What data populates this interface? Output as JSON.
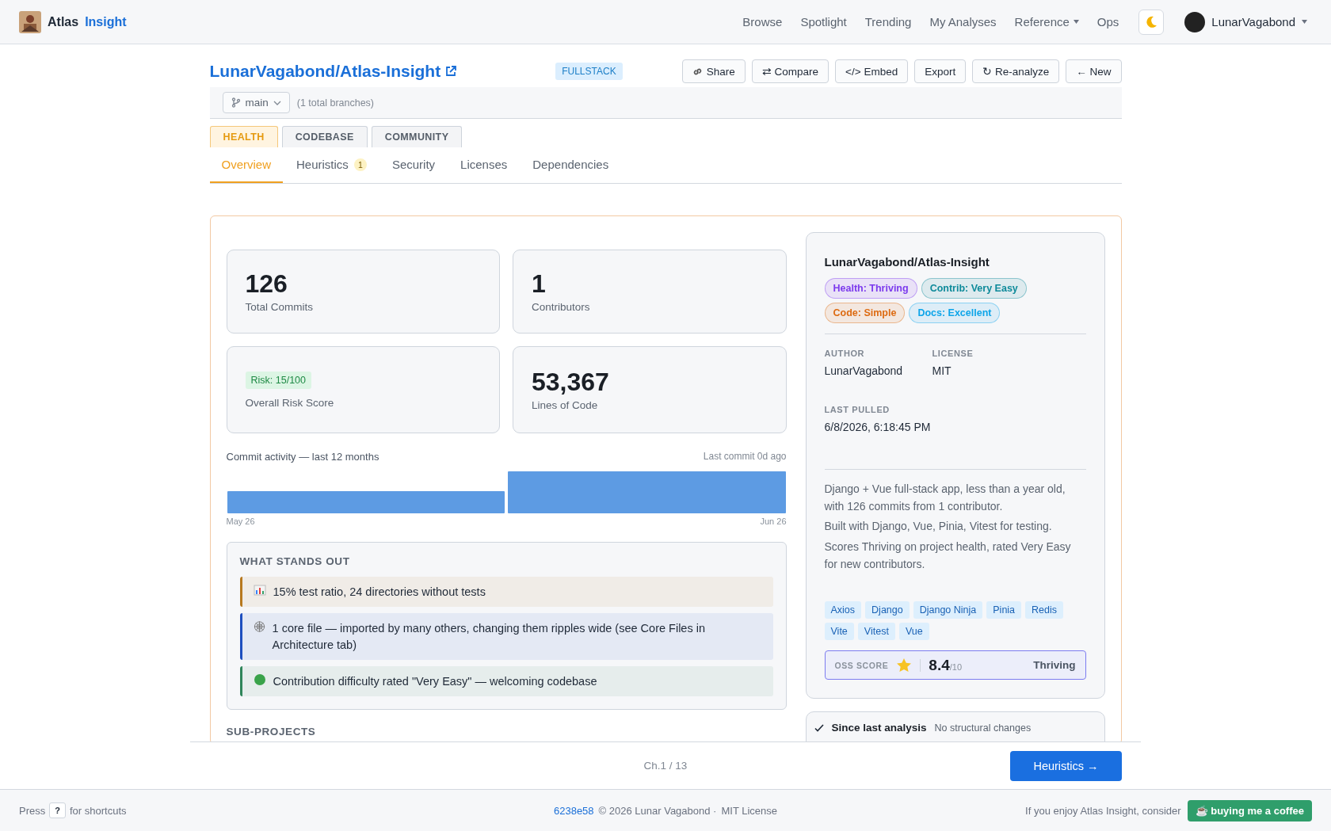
{
  "app": {
    "name_first": "Atlas",
    "name_second": "Insight"
  },
  "nav": {
    "links": [
      {
        "label": "Browse",
        "dropdown": false
      },
      {
        "label": "Spotlight",
        "dropdown": false
      },
      {
        "label": "Trending",
        "dropdown": false
      },
      {
        "label": "My Analyses",
        "dropdown": false
      },
      {
        "label": "Reference",
        "dropdown": true
      },
      {
        "label": "Ops",
        "dropdown": false
      }
    ],
    "user": {
      "name": "LunarVagabond",
      "dropdown": true
    }
  },
  "repo": {
    "title": "LunarVagabond/Atlas-Insight",
    "type_badge": "FULLSTACK",
    "actions": [
      {
        "label": "Share",
        "kind": "iconic"
      },
      {
        "label": "⇄ Compare",
        "kind": "plain"
      },
      {
        "label": "</> Embed",
        "kind": "plain"
      },
      {
        "label": "Export",
        "kind": "plain"
      },
      {
        "label": "↻ Re-analyze",
        "kind": "plain"
      },
      {
        "label": "← New",
        "kind": "plain"
      }
    ]
  },
  "branch": {
    "name": "main",
    "note": "(1 total branches)"
  },
  "tabs": [
    {
      "label": "HEALTH",
      "selected": true
    },
    {
      "label": "CODEBASE",
      "selected": false
    },
    {
      "label": "COMMUNITY",
      "selected": false
    }
  ],
  "subtabs": [
    {
      "label": "Overview",
      "selected": true
    },
    {
      "label": "Heuristics",
      "selected": false,
      "badge": "1"
    },
    {
      "label": "Security",
      "selected": false
    },
    {
      "label": "Licenses",
      "selected": false
    },
    {
      "label": "Dependencies",
      "selected": false
    }
  ],
  "stats": [
    {
      "kind": "number",
      "value": "126",
      "label": "Total Commits"
    },
    {
      "kind": "number",
      "value": "1",
      "label": "Contributors"
    },
    {
      "kind": "pill",
      "value": "Risk: 15/100",
      "label": "Overall Risk Score"
    },
    {
      "kind": "number",
      "value": "53,367",
      "label": "Lines of Code"
    }
  ],
  "activity": {
    "title": "Commit activity — last 12 months",
    "last_commit": "Last commit 0d ago",
    "start_label": "May 26",
    "end_label": "Jun 26"
  },
  "highlights": {
    "title": "WHAT STANDS OUT",
    "items": [
      {
        "kind": "chart",
        "color": "#b7791f",
        "text": "15% test ratio, 24 directories without tests"
      },
      {
        "kind": "web",
        "color": "#1e4fbf",
        "text": "1 core file — imported by many others, changing them ripples wide (see Core Files in Architecture tab)"
      },
      {
        "kind": "dot",
        "color": "#2f855a",
        "text": "Contribution difficulty rated \"Very Easy\" — welcoming codebase"
      }
    ]
  },
  "sub_projects": {
    "title": "SUB-PROJECTS"
  },
  "summary": {
    "title": "LunarVagabond/Atlas-Insight",
    "badges": [
      {
        "label": "Health: Thriving",
        "color": "#7c3aed"
      },
      {
        "label": "Contrib: Very Easy",
        "color": "#0e8a9a"
      },
      {
        "label": "Code: Simple",
        "color": "#dd6b12"
      },
      {
        "label": "Docs: Excellent",
        "color": "#0ea5e9"
      }
    ],
    "fields": [
      {
        "label": "AUTHOR",
        "value": "LunarVagabond"
      },
      {
        "label": "LICENSE",
        "value": "MIT"
      },
      {
        "label": "LAST PULLED",
        "value": "6/8/2026, 6:18:45 PM"
      }
    ],
    "paragraphs": [
      "Django + Vue full-stack app, less than a year old, with 126 commits from 1 contributor.",
      "Built with Django, Vue, Pinia, Vitest for testing.",
      "Scores Thriving on project health, rated Very Easy for new contributors."
    ],
    "tags": [
      "Axios",
      "Django",
      "Django Ninja",
      "Pinia",
      "Redis",
      "Vite",
      "Vitest",
      "Vue"
    ],
    "oss_score": {
      "label": "OSS SCORE",
      "value": "8.4",
      "max": "/10",
      "status": "Thriving"
    }
  },
  "changes": {
    "title": "Since last analysis",
    "note": "No structural changes"
  },
  "pager": {
    "position": "Ch.1 / 13",
    "next": "Heuristics →"
  },
  "footer": {
    "press": "Press",
    "key": "?",
    "shortcuts": "for shortcuts",
    "commit": "6238e58",
    "copyright": "© 2026 Lunar Vagabond ·",
    "license": "MIT License",
    "enjoy": "If you enjoy Atlas Insight, consider",
    "coffee": "☕ buying me a coffee"
  }
}
